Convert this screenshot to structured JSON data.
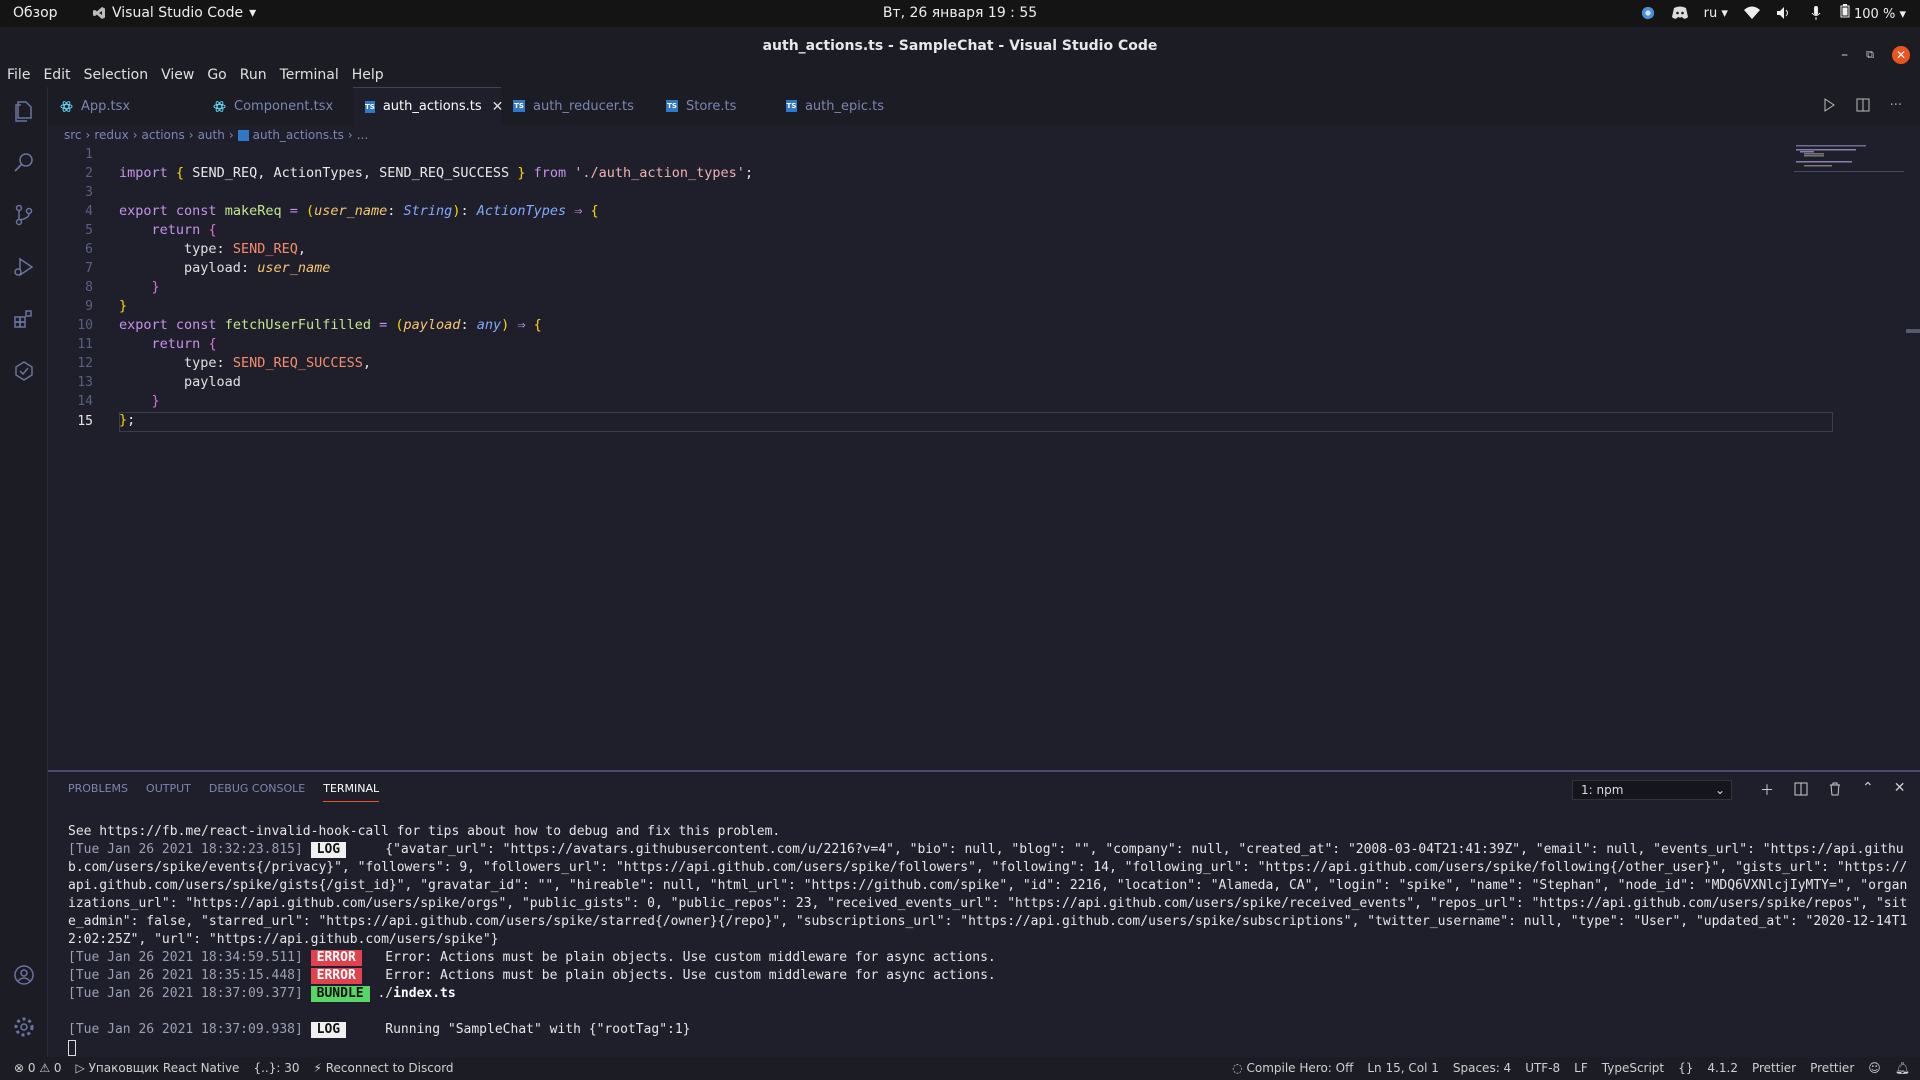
{
  "topbar": {
    "activities": "Обзор",
    "app_name": "Visual Studio Code",
    "clock": "Вт, 26 января  19 : 55",
    "lang": "ru",
    "battery": "100 %"
  },
  "window": {
    "title": "auth_actions.ts - SampleChat - Visual Studio Code"
  },
  "menu": [
    "File",
    "Edit",
    "Selection",
    "View",
    "Go",
    "Run",
    "Terminal",
    "Help"
  ],
  "tabs": [
    {
      "label": "App.tsx",
      "icon": "react-icon"
    },
    {
      "label": "Component.tsx",
      "icon": "react-icon"
    },
    {
      "label": "auth_actions.ts",
      "icon": "ts-icon",
      "active": true
    },
    {
      "label": "auth_reducer.ts",
      "icon": "ts-icon"
    },
    {
      "label": "Store.ts",
      "icon": "ts-icon"
    },
    {
      "label": "auth_epic.ts",
      "icon": "ts-icon"
    }
  ],
  "breadcrumb": [
    "src",
    "redux",
    "actions",
    "auth",
    "auth_actions.ts",
    "..."
  ],
  "editor": {
    "line_numbers": [
      "1",
      "2",
      "3",
      "4",
      "5",
      "6",
      "7",
      "8",
      "9",
      "10",
      "11",
      "12",
      "13",
      "14",
      "15"
    ],
    "l1": {
      "a": "import",
      "b": "{",
      "c": " SEND_REQ, ActionTypes, SEND_REQ_SUCCESS ",
      "d": "}",
      "e": "from",
      "f": "'./auth_action_types'",
      "g": ";"
    },
    "l3": {
      "a": "export const",
      "b": "makeReq",
      "c": " = ",
      "d": "(",
      "e": "user_name",
      "f": ": ",
      "g": "String",
      "h": ")",
      "i": ": ",
      "j": "ActionTypes",
      "k": " ⇒ ",
      "l": "{"
    },
    "l4": {
      "a": "return",
      "b": "{"
    },
    "l5": {
      "a": "type",
      "b": ": ",
      "c": "SEND_REQ",
      "d": ","
    },
    "l6": {
      "a": "payload",
      "b": ": ",
      "c": "user_name"
    },
    "l7": {
      "a": "}"
    },
    "l8": {
      "a": "}"
    },
    "l9": {
      "a": "export const",
      "b": "fetchUserFulfilled",
      "c": " = ",
      "d": "(",
      "e": "payload",
      "f": ": ",
      "g": "any",
      "h": ")",
      "i": " ⇒ ",
      "j": "{"
    },
    "l10": {
      "a": "return",
      "b": "{"
    },
    "l11": {
      "a": "type",
      "b": ": ",
      "c": "SEND_REQ_SUCCESS",
      "d": ","
    },
    "l12": {
      "a": "payload"
    },
    "l13": {
      "a": "}"
    },
    "l14": {
      "a": "}",
      "b": ";"
    }
  },
  "panel": {
    "tabs": [
      "PROBLEMS",
      "OUTPUT",
      "DEBUG CONSOLE",
      "TERMINAL"
    ],
    "terminal_select": "1: npm",
    "lines": {
      "hint": "See https://fb.me/react-invalid-hook-call for tips about how to debug and fix this problem.",
      "log1_time": "[Tue Jan 26 2021 18:32:23.815]",
      "log1_badge": "LOG",
      "log1_text": "{\"avatar_url\": \"https://avatars.githubusercontent.com/u/2216?v=4\", \"bio\": null, \"blog\": \"\", \"company\": null, \"created_at\": \"2008-03-04T21:41:39Z\", \"email\": null, \"events_url\": \"https://api.github.com/users/spike/events{/privacy}\", \"followers\": 9, \"followers_url\": \"https://api.github.com/users/spike/followers\", \"following\": 14, \"following_url\": \"https://api.github.com/users/spike/following{/other_user}\", \"gists_url\": \"https://api.github.com/users/spike/gists{/gist_id}\", \"gravatar_id\": \"\", \"hireable\": null, \"html_url\": \"https://github.com/spike\", \"id\": 2216, \"location\": \"Alameda, CA\", \"login\": \"spike\", \"name\": \"Stephan\", \"node_id\": \"MDQ6VXNlcjIyMTY=\", \"organizations_url\": \"https://api.github.com/users/spike/orgs\", \"public_gists\": 0, \"public_repos\": 23, \"received_events_url\": \"https://api.github.com/users/spike/received_events\", \"repos_url\": \"https://api.github.com/users/spike/repos\", \"site_admin\": false, \"starred_url\": \"https://api.github.com/users/spike/starred{/owner}{/repo}\", \"subscriptions_url\": \"https://api.github.com/users/spike/subscriptions\", \"twitter_username\": null, \"type\": \"User\", \"updated_at\": \"2020-12-14T12:02:25Z\", \"url\": \"https://api.github.com/users/spike\"}",
      "err1_time": "[Tue Jan 26 2021 18:34:59.511]",
      "err2_time": "[Tue Jan 26 2021 18:35:15.448]",
      "err_badge": "ERROR",
      "err_text": "Error: Actions must be plain objects. Use custom middleware for async actions.",
      "bundle_time": "[Tue Jan 26 2021 18:37:09.377]",
      "bundle_badge": "BUNDLE",
      "bundle_prefix": "./",
      "bundle_file": "index.ts",
      "log2_time": "[Tue Jan 26 2021 18:37:09.938]",
      "log2_badge": "LOG",
      "log2_text": "Running \"SampleChat\" with {\"rootTag\":1}"
    }
  },
  "status": {
    "problems": "⊗ 0 ⚠ 0",
    "packager": "Упаковщик React Native",
    "braces": "{..}: 30",
    "discord": "Reconnect to Discord",
    "compile_hero": "Compile Hero: Off",
    "position": "Ln 15, Col 1",
    "spaces": "Spaces: 4",
    "encoding": "UTF-8",
    "eol": "LF",
    "language": "TypeScript",
    "version": "4.1.2",
    "prettier1": "Prettier",
    "prettier2": "Prettier"
  },
  "colors": {
    "accent": "#e95420",
    "panel_border": "#4c4872",
    "ts_icon": "#3178c6"
  }
}
